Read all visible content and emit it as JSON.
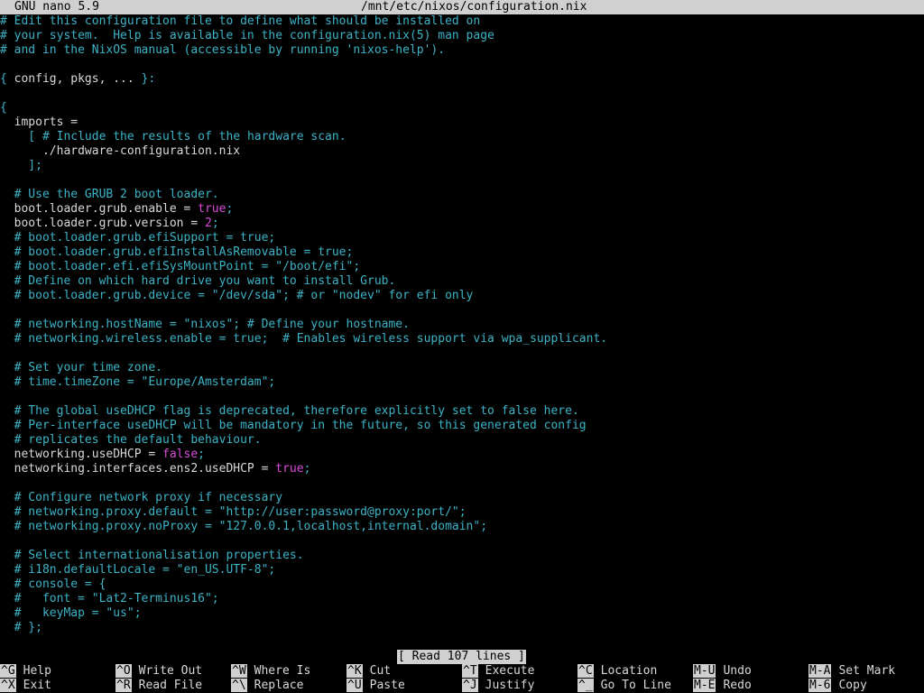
{
  "titlebar": {
    "app": "GNU nano 5.9",
    "path": "/mnt/etc/nixos/configuration.nix"
  },
  "lines": [
    {
      "segments": [
        {
          "t": "# Edit this configuration file to define what should be installed on",
          "c": "cmt"
        }
      ]
    },
    {
      "segments": [
        {
          "t": "# your system.  Help is available in the configuration.nix(5) man page",
          "c": "cmt"
        }
      ]
    },
    {
      "segments": [
        {
          "t": "# and in the NixOS manual (accessible by running 'nixos-help').",
          "c": "cmt"
        }
      ]
    },
    {
      "segments": []
    },
    {
      "segments": [
        {
          "t": "{ ",
          "c": "brace"
        },
        {
          "t": "config, pkgs, ... ",
          "c": "code"
        },
        {
          "t": "}:",
          "c": "brace"
        }
      ]
    },
    {
      "segments": []
    },
    {
      "segments": [
        {
          "t": "{",
          "c": "brace"
        }
      ]
    },
    {
      "segments": [
        {
          "t": "  imports =",
          "c": "code"
        }
      ]
    },
    {
      "segments": [
        {
          "t": "    [ ",
          "c": "brace"
        },
        {
          "t": "# Include the results of the hardware scan.",
          "c": "cmt"
        }
      ]
    },
    {
      "segments": [
        {
          "t": "      ./hardware-configuration.nix",
          "c": "code"
        }
      ]
    },
    {
      "segments": [
        {
          "t": "    ];",
          "c": "brace"
        }
      ]
    },
    {
      "segments": []
    },
    {
      "segments": [
        {
          "t": "  # Use the GRUB 2 boot loader.",
          "c": "cmt"
        }
      ]
    },
    {
      "segments": [
        {
          "t": "  boot.loader.grub.enable = ",
          "c": "code"
        },
        {
          "t": "true",
          "c": "kw"
        },
        {
          "t": ";",
          "c": "cmt"
        }
      ]
    },
    {
      "segments": [
        {
          "t": "  boot.loader.grub.version = ",
          "c": "code"
        },
        {
          "t": "2",
          "c": "kw"
        },
        {
          "t": ";",
          "c": "cmt"
        }
      ]
    },
    {
      "segments": [
        {
          "t": "  # boot.loader.grub.efiSupport = true;",
          "c": "cmt"
        }
      ]
    },
    {
      "segments": [
        {
          "t": "  # boot.loader.grub.efiInstallAsRemovable = true;",
          "c": "cmt"
        }
      ]
    },
    {
      "segments": [
        {
          "t": "  # boot.loader.efi.efiSysMountPoint = \"/boot/efi\";",
          "c": "cmt"
        }
      ]
    },
    {
      "segments": [
        {
          "t": "  # Define on which hard drive you want to install Grub.",
          "c": "cmt"
        }
      ]
    },
    {
      "segments": [
        {
          "t": "  # boot.loader.grub.device = \"/dev/sda\"; # or \"nodev\" for efi only",
          "c": "cmt"
        }
      ]
    },
    {
      "segments": []
    },
    {
      "segments": [
        {
          "t": "  # networking.hostName = \"nixos\"; # Define your hostname.",
          "c": "cmt"
        }
      ]
    },
    {
      "segments": [
        {
          "t": "  # networking.wireless.enable = true;  # Enables wireless support via wpa_supplicant.",
          "c": "cmt"
        }
      ]
    },
    {
      "segments": []
    },
    {
      "segments": [
        {
          "t": "  # Set your time zone.",
          "c": "cmt"
        }
      ]
    },
    {
      "segments": [
        {
          "t": "  # time.timeZone = \"Europe/Amsterdam\";",
          "c": "cmt"
        }
      ]
    },
    {
      "segments": []
    },
    {
      "segments": [
        {
          "t": "  # The global useDHCP flag is deprecated, therefore explicitly set to false here.",
          "c": "cmt"
        }
      ]
    },
    {
      "segments": [
        {
          "t": "  # Per-interface useDHCP will be mandatory in the future, so this generated config",
          "c": "cmt"
        }
      ]
    },
    {
      "segments": [
        {
          "t": "  # replicates the default behaviour.",
          "c": "cmt"
        }
      ]
    },
    {
      "segments": [
        {
          "t": "  networking.useDHCP = ",
          "c": "code"
        },
        {
          "t": "false",
          "c": "kw"
        },
        {
          "t": ";",
          "c": "cmt"
        }
      ]
    },
    {
      "segments": [
        {
          "t": "  networking.interfaces.ens2.useDHCP = ",
          "c": "code"
        },
        {
          "t": "true",
          "c": "kw"
        },
        {
          "t": ";",
          "c": "cmt"
        }
      ]
    },
    {
      "segments": []
    },
    {
      "segments": [
        {
          "t": "  # Configure network proxy if necessary",
          "c": "cmt"
        }
      ]
    },
    {
      "segments": [
        {
          "t": "  # networking.proxy.default = \"http://user:password@proxy:port/\";",
          "c": "cmt"
        }
      ]
    },
    {
      "segments": [
        {
          "t": "  # networking.proxy.noProxy = \"127.0.0.1,localhost,internal.domain\";",
          "c": "cmt"
        }
      ]
    },
    {
      "segments": []
    },
    {
      "segments": [
        {
          "t": "  # Select internationalisation properties.",
          "c": "cmt"
        }
      ]
    },
    {
      "segments": [
        {
          "t": "  # i18n.defaultLocale = \"en_US.UTF-8\";",
          "c": "cmt"
        }
      ]
    },
    {
      "segments": [
        {
          "t": "  # console = {",
          "c": "cmt"
        }
      ]
    },
    {
      "segments": [
        {
          "t": "  #   font = \"Lat2-Terminus16\";",
          "c": "cmt"
        }
      ]
    },
    {
      "segments": [
        {
          "t": "  #   keyMap = \"us\";",
          "c": "cmt"
        }
      ]
    },
    {
      "segments": [
        {
          "t": "  # };",
          "c": "cmt"
        }
      ]
    }
  ],
  "status": {
    "message": "[ Read 107 lines ]"
  },
  "shortcuts": [
    {
      "key": "^G",
      "label": "Help"
    },
    {
      "key": "^X",
      "label": "Exit"
    },
    {
      "key": "^O",
      "label": "Write Out"
    },
    {
      "key": "^R",
      "label": "Read File"
    },
    {
      "key": "^W",
      "label": "Where Is"
    },
    {
      "key": "^\\",
      "label": "Replace"
    },
    {
      "key": "^K",
      "label": "Cut"
    },
    {
      "key": "^U",
      "label": "Paste"
    },
    {
      "key": "^T",
      "label": "Execute"
    },
    {
      "key": "^J",
      "label": "Justify"
    },
    {
      "key": "^C",
      "label": "Location"
    },
    {
      "key": "^_",
      "label": "Go To Line"
    },
    {
      "key": "M-U",
      "label": "Undo"
    },
    {
      "key": "M-E",
      "label": "Redo"
    },
    {
      "key": "M-A",
      "label": "Set Mark"
    },
    {
      "key": "M-6",
      "label": "Copy"
    }
  ],
  "colors": {
    "background": "#000000",
    "comment": "#3cb3c6",
    "keyword": "#d84cd8",
    "text": "#d9d9d9",
    "inverse_bg": "#d0d0d0"
  }
}
